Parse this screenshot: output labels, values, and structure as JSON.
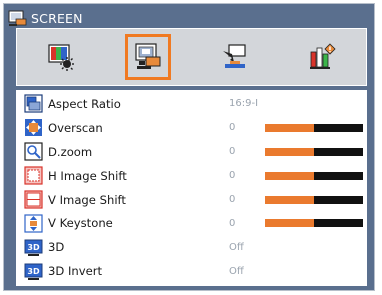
{
  "menu": {
    "title": "SCREEN",
    "title_icon": "screen-icon"
  },
  "tabs": [
    {
      "icon": "image-brightness-icon",
      "active": false
    },
    {
      "icon": "screen-icon",
      "active": true
    },
    {
      "icon": "setup-icon",
      "active": false
    },
    {
      "icon": "options-icon",
      "active": false
    }
  ],
  "items": [
    {
      "label": "Aspect Ratio",
      "value": "16:9-I",
      "icon": "aspect-ratio-icon",
      "bar": null
    },
    {
      "label": "Overscan",
      "value": "0",
      "icon": "overscan-icon",
      "bar": 0.5
    },
    {
      "label": "D.zoom",
      "value": "0",
      "icon": "zoom-icon",
      "bar": 0.5
    },
    {
      "label": "H Image Shift",
      "value": "0",
      "icon": "h-shift-icon",
      "bar": 0.5
    },
    {
      "label": "V Image Shift",
      "value": "0",
      "icon": "v-shift-icon",
      "bar": 0.5
    },
    {
      "label": "V Keystone",
      "value": "0",
      "icon": "keystone-icon",
      "bar": 0.5
    },
    {
      "label": "3D",
      "value": "Off",
      "icon": "3d-icon",
      "bar": null
    },
    {
      "label": "3D Invert",
      "value": "Off",
      "icon": "3d-invert-icon",
      "bar": null
    }
  ],
  "colors": {
    "accent": "#f07a22",
    "bar_fill": "#ea7a2e",
    "bar_track": "#111111",
    "frame": "#5a6f8e",
    "value_text": "#9aa3ae"
  }
}
